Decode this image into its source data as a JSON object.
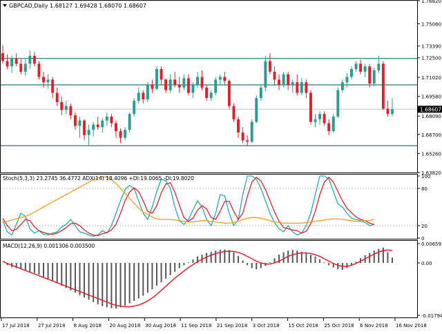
{
  "window": {
    "symbol_info": "GBPCAD,Daily  1.68127 1.69428 1.68070 1.68607",
    "current_price": "1.68607"
  },
  "price_axis": {
    "ticks": [
      "1.76820",
      "1.75080",
      "1.73390",
      "1.72500",
      "1.71020",
      "1.69580",
      "1.68090",
      "1.66700",
      "1.65260",
      "1.63820"
    ]
  },
  "time_axis": {
    "ticks": [
      "17 Jul 2018",
      "27 Jul 2018",
      "8 Aug 2018",
      "20 Aug 2018",
      "30 Aug 2018",
      "11 Sep 2018",
      "21 Sep 2018",
      "3 Oct 2018",
      "15 Oct 2018",
      "25 Oct 2018",
      "6 Nov 2018",
      "16 Nov 2018"
    ]
  },
  "stoch_panel": {
    "label": "Stoch(5,3,3) 23.2745 36.4772  ADX(14) 18.4096 +DI:19.0065 -DI:19.8020",
    "ticks": [
      "100",
      "80",
      "20",
      "0"
    ]
  },
  "macd_panel": {
    "label": "MACD(12,26,9) 0.001306 0.003500",
    "ticks": [
      "0.006592",
      "0.00",
      "-0.017944"
    ]
  },
  "colors": {
    "bull": "#2a9d8f",
    "bear": "#e0202c",
    "level_line": "#1f7a6d",
    "stoch_main": "#2aa8a8",
    "stoch_signal": "#e0202c",
    "adx": "#f39c1e",
    "macd_hist": "#555555",
    "macd_signal": "#e0202c"
  },
  "chart_data": [
    {
      "type": "candlestick",
      "title": "GBPCAD,Daily",
      "ylim": [
        1.6382,
        1.7682
      ],
      "horizontal_levels": [
        1.7245,
        1.7045,
        1.6585
      ],
      "current_price": 1.68607,
      "candles": [
        [
          1.7285,
          1.7345,
          1.7205,
          1.7225
        ],
        [
          1.7225,
          1.7275,
          1.7165,
          1.7185
        ],
        [
          1.7185,
          1.7265,
          1.7135,
          1.7245
        ],
        [
          1.7245,
          1.7285,
          1.7185,
          1.7205
        ],
        [
          1.7205,
          1.7245,
          1.7125,
          1.7145
        ],
        [
          1.7145,
          1.7245,
          1.7115,
          1.7205
        ],
        [
          1.7205,
          1.7305,
          1.7165,
          1.7265
        ],
        [
          1.7265,
          1.7295,
          1.7185,
          1.7205
        ],
        [
          1.7205,
          1.7225,
          1.7085,
          1.7105
        ],
        [
          1.7105,
          1.7145,
          1.7025,
          1.7065
        ],
        [
          1.7065,
          1.7125,
          1.7015,
          1.7085
        ],
        [
          1.7085,
          1.7105,
          1.6945,
          1.6985
        ],
        [
          1.6985,
          1.7025,
          1.6885,
          1.6915
        ],
        [
          1.6915,
          1.6955,
          1.6815,
          1.6855
        ],
        [
          1.6855,
          1.6925,
          1.6825,
          1.6885
        ],
        [
          1.6885,
          1.6905,
          1.6785,
          1.6815
        ],
        [
          1.6815,
          1.6835,
          1.6705,
          1.6735
        ],
        [
          1.6735,
          1.6805,
          1.6645,
          1.6775
        ],
        [
          1.6775,
          1.6785,
          1.6625,
          1.6665
        ],
        [
          1.6665,
          1.6745,
          1.6585,
          1.6705
        ],
        [
          1.6705,
          1.6765,
          1.6655,
          1.6745
        ],
        [
          1.6745,
          1.6805,
          1.6705,
          1.6725
        ],
        [
          1.6725,
          1.6795,
          1.6685,
          1.6775
        ],
        [
          1.6775,
          1.6835,
          1.6735,
          1.6805
        ],
        [
          1.6805,
          1.6825,
          1.6725,
          1.6755
        ],
        [
          1.6755,
          1.6775,
          1.6645,
          1.6695
        ],
        [
          1.6695,
          1.6715,
          1.6605,
          1.6645
        ],
        [
          1.6645,
          1.6725,
          1.6625,
          1.6705
        ],
        [
          1.6705,
          1.6835,
          1.6685,
          1.6825
        ],
        [
          1.6825,
          1.6945,
          1.6805,
          1.6925
        ],
        [
          1.6925,
          1.7025,
          1.6905,
          1.6985
        ],
        [
          1.6985,
          1.7005,
          1.6905,
          1.6935
        ],
        [
          1.6935,
          1.7065,
          1.6915,
          1.7045
        ],
        [
          1.7045,
          1.7085,
          1.6985,
          1.7015
        ],
        [
          1.7015,
          1.7185,
          1.7005,
          1.7165
        ],
        [
          1.7165,
          1.7185,
          1.7045,
          1.7085
        ],
        [
          1.7085,
          1.7095,
          1.6985,
          1.7005
        ],
        [
          1.7005,
          1.7125,
          1.6985,
          1.7085
        ],
        [
          1.7085,
          1.7145,
          1.7025,
          1.7045
        ],
        [
          1.7045,
          1.7105,
          1.6985,
          1.7025
        ],
        [
          1.7025,
          1.7125,
          1.7005,
          1.7095
        ],
        [
          1.7095,
          1.7125,
          1.6965,
          1.6985
        ],
        [
          1.6985,
          1.7065,
          1.6945,
          1.7045
        ],
        [
          1.7045,
          1.7145,
          1.7025,
          1.7105
        ],
        [
          1.7105,
          1.7155,
          1.7005,
          1.7025
        ],
        [
          1.7025,
          1.7045,
          1.6925,
          1.6945
        ],
        [
          1.6945,
          1.7005,
          1.6925,
          1.6985
        ],
        [
          1.6985,
          1.7105,
          1.6965,
          1.7085
        ],
        [
          1.7085,
          1.7125,
          1.7045,
          1.7105
        ],
        [
          1.7105,
          1.7145,
          1.7045,
          1.7075
        ],
        [
          1.7075,
          1.7085,
          1.6865,
          1.6885
        ],
        [
          1.6885,
          1.6905,
          1.6765,
          1.6785
        ],
        [
          1.6785,
          1.6805,
          1.6645,
          1.6685
        ],
        [
          1.6685,
          1.6725,
          1.6605,
          1.6625
        ],
        [
          1.6625,
          1.6665,
          1.6585,
          1.6615
        ],
        [
          1.6615,
          1.6785,
          1.6605,
          1.6765
        ],
        [
          1.6765,
          1.6965,
          1.6755,
          1.6945
        ],
        [
          1.6945,
          1.7045,
          1.6925,
          1.7025
        ],
        [
          1.7025,
          1.7265,
          1.6995,
          1.7225
        ],
        [
          1.7225,
          1.7285,
          1.7125,
          1.7145
        ],
        [
          1.7145,
          1.7185,
          1.7045,
          1.7085
        ],
        [
          1.7085,
          1.7125,
          1.7005,
          1.7045
        ],
        [
          1.7045,
          1.7145,
          1.7025,
          1.7125
        ],
        [
          1.7125,
          1.7145,
          1.7005,
          1.7045
        ],
        [
          1.7045,
          1.7085,
          1.6985,
          1.7065
        ],
        [
          1.7065,
          1.7125,
          1.6965,
          1.6985
        ],
        [
          1.6985,
          1.7095,
          1.6965,
          1.7065
        ],
        [
          1.7065,
          1.7085,
          1.6945,
          1.6985
        ],
        [
          1.6985,
          1.7005,
          1.6745,
          1.6765
        ],
        [
          1.6765,
          1.6825,
          1.6725,
          1.6785
        ],
        [
          1.6785,
          1.6845,
          1.6745,
          1.6825
        ],
        [
          1.6825,
          1.6845,
          1.6735,
          1.6755
        ],
        [
          1.6755,
          1.6785,
          1.6665,
          1.6695
        ],
        [
          1.6695,
          1.6825,
          1.6685,
          1.6805
        ],
        [
          1.6805,
          1.7025,
          1.6795,
          1.7005
        ],
        [
          1.7005,
          1.7085,
          1.6985,
          1.7065
        ],
        [
          1.7065,
          1.7135,
          1.7025,
          1.7105
        ],
        [
          1.7105,
          1.7185,
          1.7085,
          1.7165
        ],
        [
          1.7165,
          1.7225,
          1.7145,
          1.7205
        ],
        [
          1.7205,
          1.7235,
          1.7125,
          1.7145
        ],
        [
          1.7145,
          1.7205,
          1.7105,
          1.7185
        ],
        [
          1.7185,
          1.7205,
          1.7025,
          1.7055
        ],
        [
          1.7055,
          1.7175,
          1.7035,
          1.7155
        ],
        [
          1.7155,
          1.7265,
          1.7135,
          1.7205
        ],
        [
          1.7205,
          1.7225,
          1.6855,
          1.6865
        ],
        [
          1.6865,
          1.6925,
          1.6805,
          1.6825
        ],
        [
          1.6825,
          1.6945,
          1.6805,
          1.68607
        ]
      ]
    },
    {
      "type": "line",
      "title": "Stoch(5,3,3) / ADX(14)",
      "ylim": [
        0,
        100
      ],
      "levels": [
        80,
        20
      ],
      "series": [
        {
          "name": "Stoch main",
          "values": [
            28,
            10,
            5,
            22,
            40,
            35,
            15,
            8,
            12,
            6,
            5,
            8,
            10,
            18,
            22,
            30,
            20,
            10,
            8,
            5,
            3,
            5,
            12,
            8,
            20,
            40,
            60,
            78,
            85,
            80,
            60,
            40,
            30,
            50,
            75,
            95,
            92,
            80,
            50,
            28,
            22,
            30,
            45,
            60,
            50,
            30,
            20,
            40,
            70,
            68,
            40,
            20,
            30,
            70,
            100,
            100,
            95,
            80,
            60,
            40,
            25,
            15,
            10,
            20,
            10,
            5,
            8,
            20,
            40,
            70,
            100,
            100,
            95,
            75,
            55,
            50,
            40,
            32,
            30,
            28,
            25,
            20,
            22
          ]
        },
        {
          "name": "Stoch signal",
          "values": [
            32,
            20,
            12,
            14,
            22,
            30,
            28,
            18,
            12,
            9,
            7,
            6,
            8,
            12,
            17,
            23,
            24,
            20,
            13,
            8,
            5,
            4,
            7,
            9,
            13,
            22,
            40,
            60,
            74,
            81,
            75,
            60,
            43,
            40,
            52,
            73,
            87,
            89,
            74,
            53,
            33,
            27,
            32,
            45,
            52,
            47,
            33,
            30,
            43,
            59,
            59,
            43,
            30,
            40,
            67,
            90,
            98,
            92,
            78,
            60,
            42,
            27,
            17,
            15,
            13,
            12,
            8,
            11,
            23,
            43,
            70,
            90,
            98,
            90,
            75,
            60,
            48,
            41,
            34,
            30,
            28,
            24,
            22
          ]
        },
        {
          "name": "ADX",
          "values": [
            25,
            27,
            29,
            31,
            33,
            35,
            38,
            42,
            46,
            50,
            54,
            58,
            62,
            66,
            70,
            74,
            78,
            82,
            86,
            90,
            94,
            97,
            99,
            98,
            94,
            88,
            80,
            72,
            64,
            56,
            48,
            42,
            38,
            34,
            31,
            30,
            30,
            30,
            29,
            28,
            27,
            26,
            26,
            27,
            28,
            28,
            27,
            26,
            25,
            24,
            24,
            25,
            27,
            30,
            32,
            33,
            33,
            32,
            30,
            28,
            26,
            25,
            24,
            24,
            24,
            24,
            24,
            25,
            26,
            27,
            28,
            29,
            30,
            31,
            31,
            30,
            29,
            28,
            27,
            27,
            28,
            28,
            30
          ]
        }
      ]
    },
    {
      "type": "bar",
      "title": "MACD(12,26,9)",
      "ylim": [
        -0.017944,
        0.006592
      ],
      "series": [
        {
          "name": "MACD histogram",
          "values": [
            0.0,
            -0.0008,
            -0.0015,
            -0.0018,
            -0.002,
            -0.0025,
            -0.003,
            -0.0035,
            -0.004,
            -0.0048,
            -0.0055,
            -0.0062,
            -0.007,
            -0.0078,
            -0.0086,
            -0.0094,
            -0.0102,
            -0.011,
            -0.0118,
            -0.0126,
            -0.0134,
            -0.0142,
            -0.0148,
            -0.0152,
            -0.0155,
            -0.0156,
            -0.0152,
            -0.0146,
            -0.0138,
            -0.013,
            -0.0122,
            -0.0112,
            -0.0102,
            -0.009,
            -0.0078,
            -0.0066,
            -0.0054,
            -0.0042,
            -0.003,
            -0.0018,
            -0.0008,
            0.0002,
            0.0012,
            0.0022,
            0.0028,
            0.0034,
            0.0038,
            0.0042,
            0.0045,
            0.0046,
            0.0044,
            0.0036,
            0.0024,
            0.0008,
            -0.0008,
            -0.0018,
            -0.0022,
            -0.0018,
            -0.001,
            0.0002,
            0.0016,
            0.0028,
            0.0036,
            0.0042,
            0.0044,
            0.0042,
            0.0038,
            0.0034,
            0.0028,
            0.0022,
            0.0012,
            0.0002,
            -0.0008,
            -0.0016,
            -0.0022,
            -0.0024,
            -0.0018,
            -0.0008,
            0.0004,
            0.0016,
            0.0026,
            0.0034,
            0.0042,
            0.0048,
            0.0052,
            0.0036,
            0.0018
          ]
        },
        {
          "name": "Signal",
          "values": [
            0.0005,
            -0.0002,
            -0.0008,
            -0.0014,
            -0.002,
            -0.0026,
            -0.0032,
            -0.0038,
            -0.0044,
            -0.005,
            -0.0056,
            -0.0062,
            -0.0068,
            -0.0074,
            -0.008,
            -0.0086,
            -0.0092,
            -0.0098,
            -0.0104,
            -0.011,
            -0.0116,
            -0.0122,
            -0.0128,
            -0.0134,
            -0.014,
            -0.0145,
            -0.0148,
            -0.015,
            -0.015,
            -0.0148,
            -0.0144,
            -0.0138,
            -0.013,
            -0.012,
            -0.0108,
            -0.0094,
            -0.008,
            -0.0066,
            -0.0052,
            -0.004,
            -0.0028,
            -0.0016,
            -0.0006,
            0.0004,
            0.0012,
            0.002,
            0.0026,
            0.0032,
            0.0036,
            0.0039,
            0.004,
            0.0039,
            0.0036,
            0.003,
            0.0022,
            0.0014,
            0.0006,
            0.0,
            -0.0004,
            -0.0004,
            0.0,
            0.0006,
            0.0014,
            0.0022,
            0.0028,
            0.0032,
            0.0034,
            0.0034,
            0.0032,
            0.0028,
            0.0022,
            0.0014,
            0.0006,
            -0.0002,
            -0.0008,
            -0.0012,
            -0.0012,
            -0.0008,
            -0.0002,
            0.0006,
            0.0014,
            0.0022,
            0.003,
            0.0037,
            0.0042,
            0.0044,
            0.0042
          ]
        }
      ]
    }
  ]
}
